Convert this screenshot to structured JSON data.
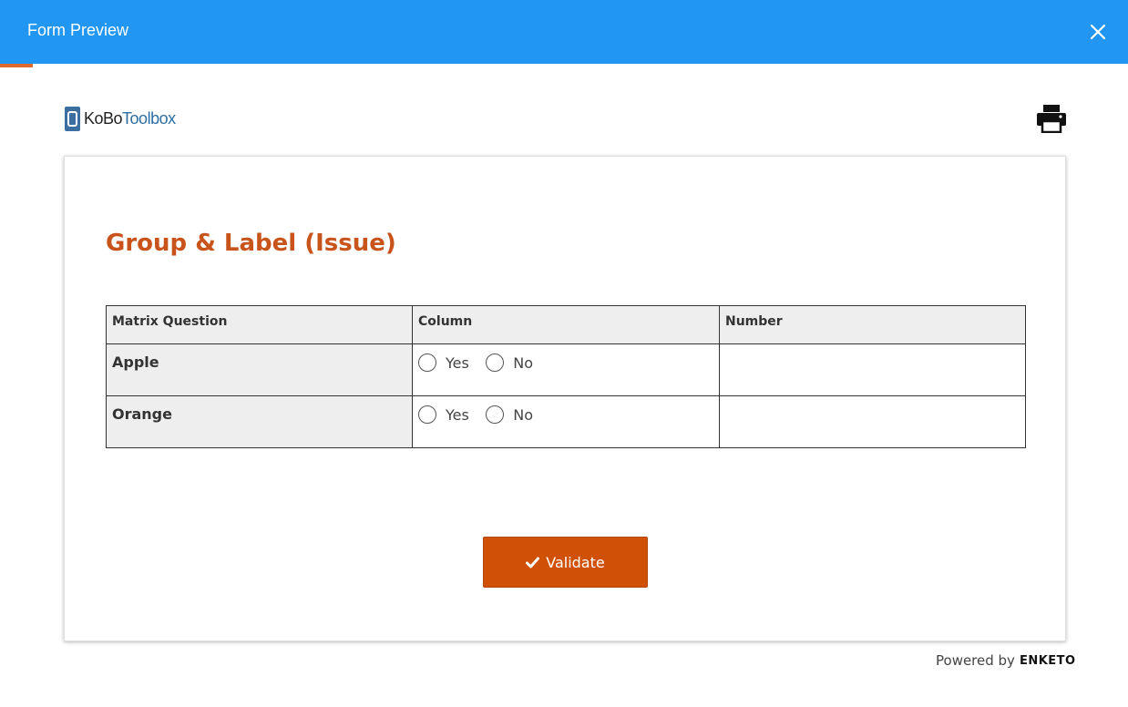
{
  "header": {
    "title": "Form Preview",
    "bg_color": "#2196f3",
    "close_icon": "close-icon"
  },
  "logo": {
    "kobo": "KoBo",
    "toolbox": "Toolbox"
  },
  "print_icon": "print-icon",
  "form": {
    "title": "Group & Label (Issue)",
    "title_color": "#c8531b",
    "matrix": {
      "headers": [
        "Matrix Question",
        "Column",
        "Number"
      ],
      "rows": [
        {
          "label": "Apple",
          "options": [
            "Yes",
            "No"
          ],
          "number": ""
        },
        {
          "label": "Orange",
          "options": [
            "Yes",
            "No"
          ],
          "number": ""
        }
      ]
    },
    "validate_label": "Validate",
    "validate_color": "#d05005"
  },
  "footer": {
    "powered_by": "Powered by",
    "brand": "ENKETO"
  }
}
